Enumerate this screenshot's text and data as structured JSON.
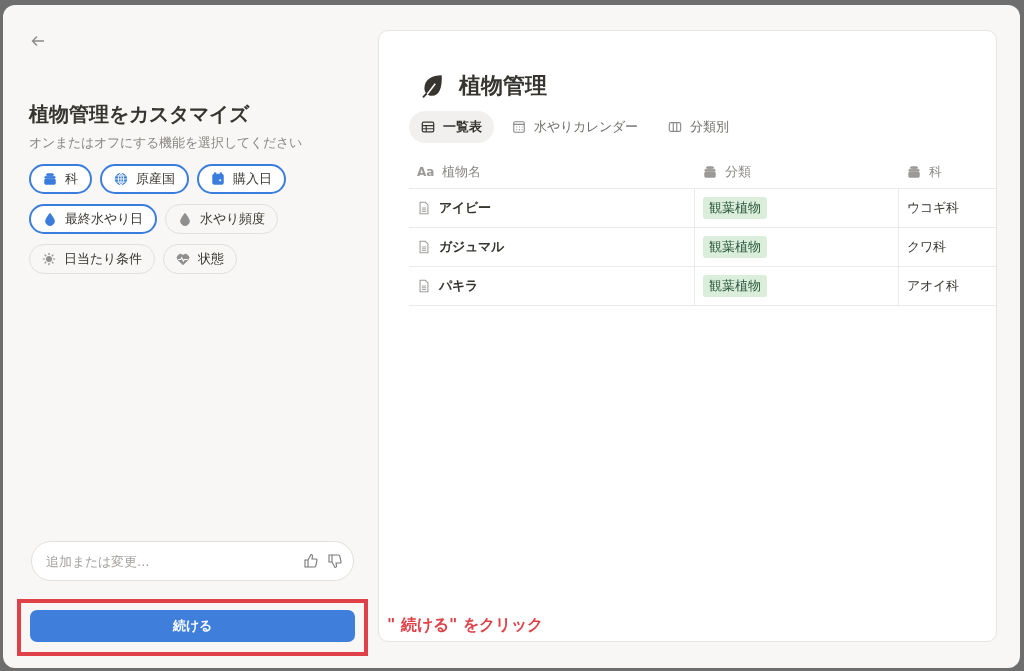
{
  "panel": {
    "title": "植物管理をカスタマイズ",
    "subtitle": "オンまたはオフにする機能を選択してください",
    "features": [
      {
        "label": "科",
        "kind": "select",
        "selected": true
      },
      {
        "label": "原産国",
        "kind": "globe",
        "selected": true
      },
      {
        "label": "購入日",
        "kind": "calendar",
        "selected": true
      },
      {
        "label": "最終水やり日",
        "kind": "drop",
        "selected": true
      },
      {
        "label": "水やり頻度",
        "kind": "drop",
        "selected": false
      },
      {
        "label": "日当たり条件",
        "kind": "sun",
        "selected": false
      },
      {
        "label": "状態",
        "kind": "heart",
        "selected": false
      }
    ],
    "input": {
      "placeholder": "追加または変更..."
    },
    "continue_button": "続ける"
  },
  "preview": {
    "title": "植物管理",
    "tabs": [
      {
        "label": "一覧表",
        "kind": "table",
        "selected": true
      },
      {
        "label": "水やりカレンダー",
        "kind": "calendar",
        "selected": false
      },
      {
        "label": "分類別",
        "kind": "board",
        "selected": false
      }
    ],
    "table": {
      "columns": [
        {
          "label": "植物名",
          "kind": "title",
          "icon_text": "Aa"
        },
        {
          "label": "分類",
          "kind": "select"
        },
        {
          "label": "科",
          "kind": "select"
        }
      ],
      "rows": [
        [
          "アイビー",
          "観葉植物",
          "ウコギ科"
        ],
        [
          "ガジュマル",
          "観葉植物",
          "クワ科"
        ],
        [
          "パキラ",
          "観葉植物",
          "アオイ科"
        ]
      ]
    }
  },
  "annotation": {
    "text": "\" 続ける\" をクリック"
  }
}
